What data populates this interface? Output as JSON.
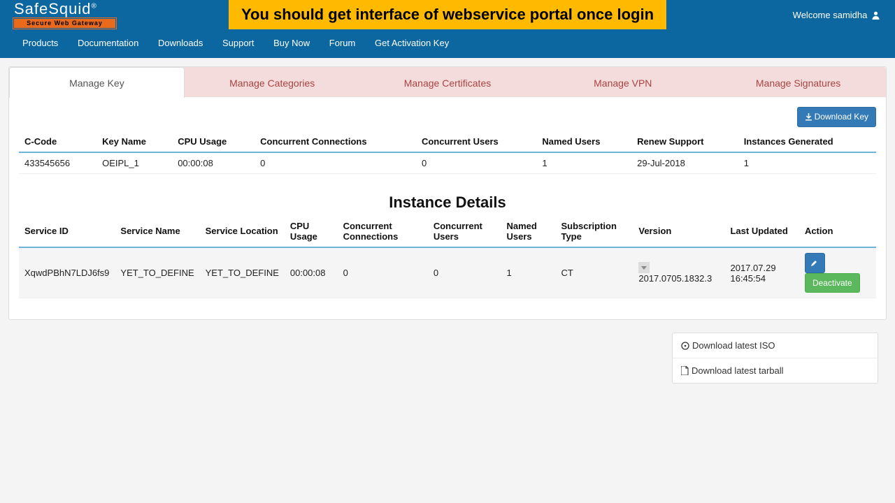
{
  "brand": {
    "name": "SafeSquid",
    "reg": "®",
    "tagline": "Secure Web Gateway"
  },
  "banner": "You should get interface of webservice portal once login",
  "welcome": "Welcome samidha",
  "nav": {
    "products": "Products",
    "documentation": "Documentation",
    "downloads": "Downloads",
    "support": "Support",
    "buynow": "Buy Now",
    "forum": "Forum",
    "activation": "Get Activation Key"
  },
  "tabs": {
    "manage_key": "Manage Key",
    "manage_categories": "Manage Categories",
    "manage_certificates": "Manage Certificates",
    "manage_vpn": "Manage VPN",
    "manage_signatures": "Manage Signatures"
  },
  "download_key_btn": "Download Key",
  "key_table": {
    "headers": {
      "ccode": "C-Code",
      "keyname": "Key Name",
      "cpu": "CPU Usage",
      "conn": "Concurrent Connections",
      "users": "Concurrent Users",
      "named": "Named Users",
      "renew": "Renew Support",
      "instances": "Instances Generated"
    },
    "row": {
      "ccode": "433545656",
      "keyname": "OEIPL_1",
      "cpu": "00:00:08",
      "conn": "0",
      "users": "0",
      "named": "1",
      "renew": "29-Jul-2018",
      "instances": "1"
    }
  },
  "instance_title": "Instance Details",
  "instance_table": {
    "headers": {
      "sid": "Service ID",
      "sname": "Service Name",
      "sloc": "Service Location",
      "cpu": "CPU Usage",
      "conn": "Concurrent Connections",
      "users": "Concurrent Users",
      "named": "Named Users",
      "subtype": "Subscription Type",
      "version": "Version",
      "updated": "Last Updated",
      "action": "Action"
    },
    "row": {
      "sid": "XqwdPBhN7LDJ6fs9",
      "sname": "YET_TO_DEFINE",
      "sloc": "YET_TO_DEFINE",
      "cpu": "00:00:08",
      "conn": "0",
      "users": "0",
      "named": "1",
      "subtype": "CT",
      "version": "2017.0705.1832.3",
      "updated": "2017.07.29 16:45:54",
      "deactivate": "Deactivate"
    }
  },
  "side_downloads": {
    "iso": "Download latest ISO",
    "tarball": "Download latest tarball"
  }
}
